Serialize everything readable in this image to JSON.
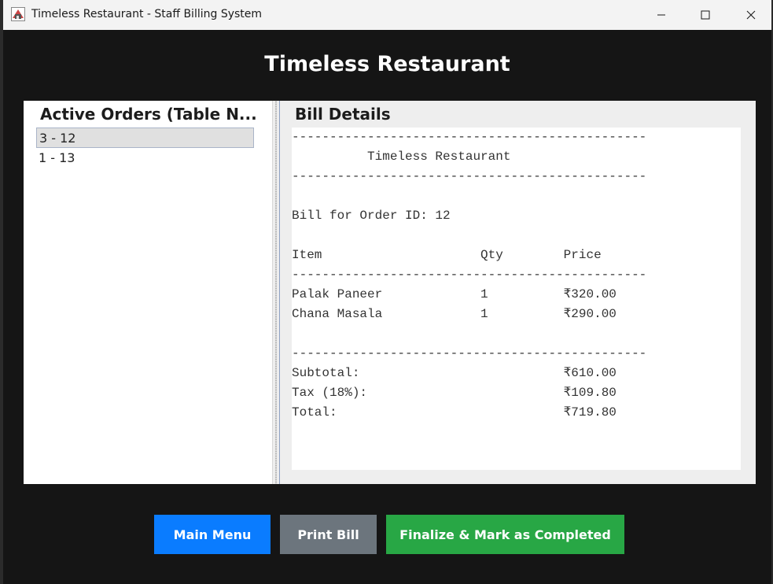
{
  "window": {
    "title": "Timeless Restaurant - Staff Billing System",
    "controls": {
      "minimize": "minimize-icon",
      "maximize": "maximize-icon",
      "close": "close-icon"
    }
  },
  "header": {
    "title": "Timeless Restaurant"
  },
  "orders": {
    "title": "Active Orders (Table N...",
    "items": [
      "3 - 12",
      "1 - 13"
    ],
    "selected_index": 0
  },
  "bill": {
    "title": "Bill Details",
    "text": "-----------------------------------------------\n          Timeless Restaurant\n-----------------------------------------------\n\nBill for Order ID: 12\n\nItem                     Qty        Price\n-----------------------------------------------\nPalak Paneer             1          ₹320.00\nChana Masala             1          ₹290.00\n\n-----------------------------------------------\nSubtotal:                           ₹610.00\nTax (18%):                          ₹109.80\nTotal:                              ₹719.80"
  },
  "buttons": {
    "main_menu": "Main Menu",
    "print_bill": "Print Bill",
    "finalize": "Finalize & Mark as Completed"
  },
  "colors": {
    "background": "#151515",
    "main_menu": "#0a7cff",
    "print_bill": "#6c757d",
    "finalize": "#28a745"
  }
}
